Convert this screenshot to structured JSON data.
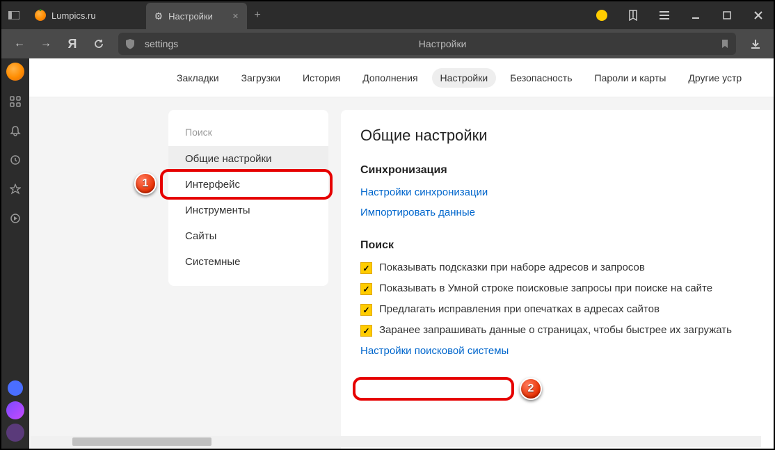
{
  "titlebar": {
    "tab1": "Lumpics.ru",
    "tab2": "Настройки"
  },
  "toolbar": {
    "url": "settings",
    "page_label": "Настройки"
  },
  "topnav": {
    "items": [
      "Закладки",
      "Загрузки",
      "История",
      "Дополнения",
      "Настройки",
      "Безопасность",
      "Пароли и карты",
      "Другие устр"
    ]
  },
  "leftmenu": {
    "section": "Поиск",
    "items": [
      "Общие настройки",
      "Интерфейс",
      "Инструменты",
      "Сайты",
      "Системные"
    ]
  },
  "panel": {
    "title": "Общие настройки",
    "sync_heading": "Синхронизация",
    "sync_link1": "Настройки синхронизации",
    "sync_link2": "Импортировать данные",
    "search_heading": "Поиск",
    "cb1": "Показывать подсказки при наборе адресов и запросов",
    "cb2": "Показывать в Умной строке поисковые запросы при поиске на сайте",
    "cb3": "Предлагать исправления при опечатках в адресах сайтов",
    "cb4": "Заранее запрашивать данные о страницах, чтобы быстрее их загружать",
    "search_engine_link": "Настройки поисковой системы"
  },
  "annotations": {
    "a1": "1",
    "a2": "2"
  }
}
